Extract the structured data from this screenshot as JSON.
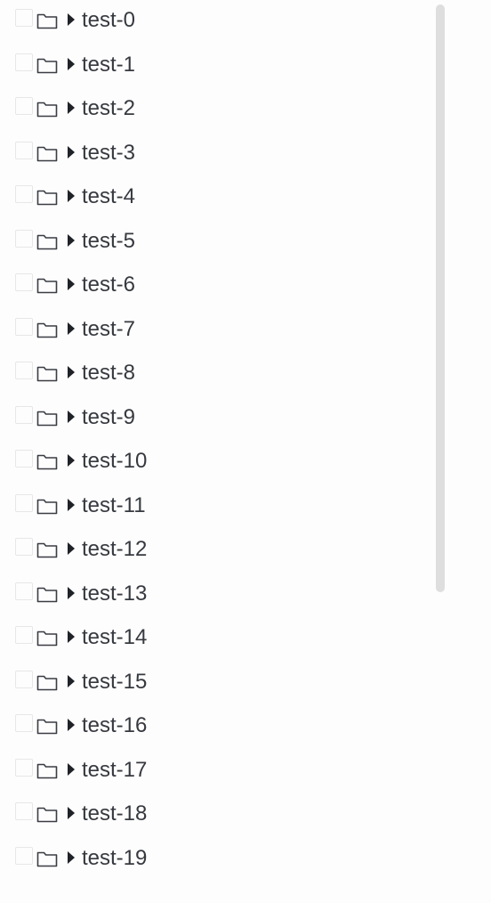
{
  "tree": {
    "nodes": [
      {
        "label": "test-0"
      },
      {
        "label": "test-1"
      },
      {
        "label": "test-2"
      },
      {
        "label": "test-3"
      },
      {
        "label": "test-4"
      },
      {
        "label": "test-5"
      },
      {
        "label": "test-6"
      },
      {
        "label": "test-7"
      },
      {
        "label": "test-8"
      },
      {
        "label": "test-9"
      },
      {
        "label": "test-10"
      },
      {
        "label": "test-11"
      },
      {
        "label": "test-12"
      },
      {
        "label": "test-13"
      },
      {
        "label": "test-14"
      },
      {
        "label": "test-15"
      },
      {
        "label": "test-16"
      },
      {
        "label": "test-17"
      },
      {
        "label": "test-18"
      },
      {
        "label": "test-19"
      }
    ],
    "icons": {
      "node_icon": "folder-icon",
      "expander_icon": "caret-right-icon"
    }
  }
}
